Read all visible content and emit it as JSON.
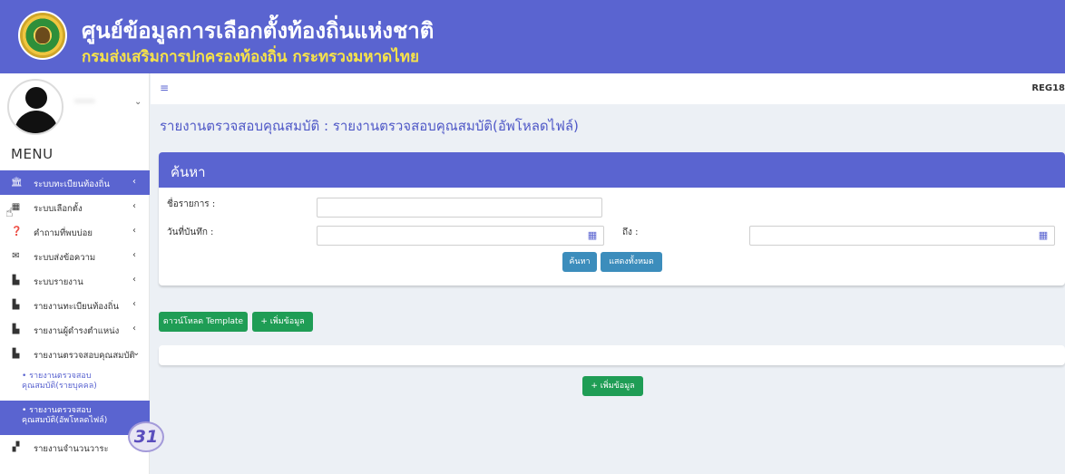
{
  "header": {
    "title": "ศูนย์ข้อมูลการเลือกตั้งท้องถิ่นแห่งชาติ",
    "subtitle": "กรมส่งเสริมการปกครองท้องถิ่น กระทรวงมหาดไทย"
  },
  "user": {
    "name": "*****"
  },
  "sidebar": {
    "menu_title": "MENU",
    "items": [
      {
        "label": "ระบบทะเบียนท้องถิ่น",
        "icon": "bank-icon",
        "glyph": "🏛"
      },
      {
        "label": "ระบบเลือกตั้ง",
        "icon": "calendar-icon",
        "glyph": "▦"
      },
      {
        "label": "คำถามที่พบบ่อย",
        "icon": "question-icon",
        "glyph": "❓"
      },
      {
        "label": "ระบบส่งข้อความ",
        "icon": "envelope-icon",
        "glyph": "✉"
      },
      {
        "label": "ระบบรายงาน",
        "icon": "file-icon",
        "glyph": "▙"
      },
      {
        "label": "รายงานทะเบียนท้องถิ่น",
        "icon": "file-text-icon",
        "glyph": "▙"
      },
      {
        "label": "รายงานผู้ดำรงตำแหน่ง",
        "icon": "file-text-icon",
        "glyph": "▙"
      },
      {
        "label": "รายงานตรวจสอบคุณสมบัติ",
        "icon": "file-check-icon",
        "glyph": "▙"
      },
      {
        "label": "รายงานจำนวนวาระ",
        "icon": "chart-icon",
        "glyph": "▞"
      }
    ],
    "subitems": [
      {
        "label": "• รายงานตรวจสอบ\nคุณสมบัติ(รายบุคคล)"
      },
      {
        "label": "• รายงานตรวจสอบ\nคุณสมบัติ(อัพโหลดไฟล์)"
      }
    ]
  },
  "step_badge": "31",
  "navbar": {
    "reg_id": "REG18"
  },
  "page": {
    "heading": "รายงานตรวจสอบคุณสมบัติ : รายงานตรวจสอบคุณสมบัติ(อัพโหลดไฟล์)"
  },
  "search": {
    "title": "ค้นหา",
    "name_label": "ชื่อรายการ :",
    "date_label": "วันที่บันทึก :",
    "to_label": "ถึง :",
    "search_button": "ค้นหา",
    "show_all_button": "แสดงทั้งหมด"
  },
  "actions": {
    "download_template": "ดาวน์โหลด Template",
    "add_data": "+ เพิ่มข้อมูล",
    "add_data_bottom": "+ เพิ่มข้อมูล"
  },
  "colors": {
    "primary": "#5a64d0",
    "header_subtitle": "#f6e24a",
    "success": "#1f9d55",
    "info": "#3c8dbc"
  }
}
